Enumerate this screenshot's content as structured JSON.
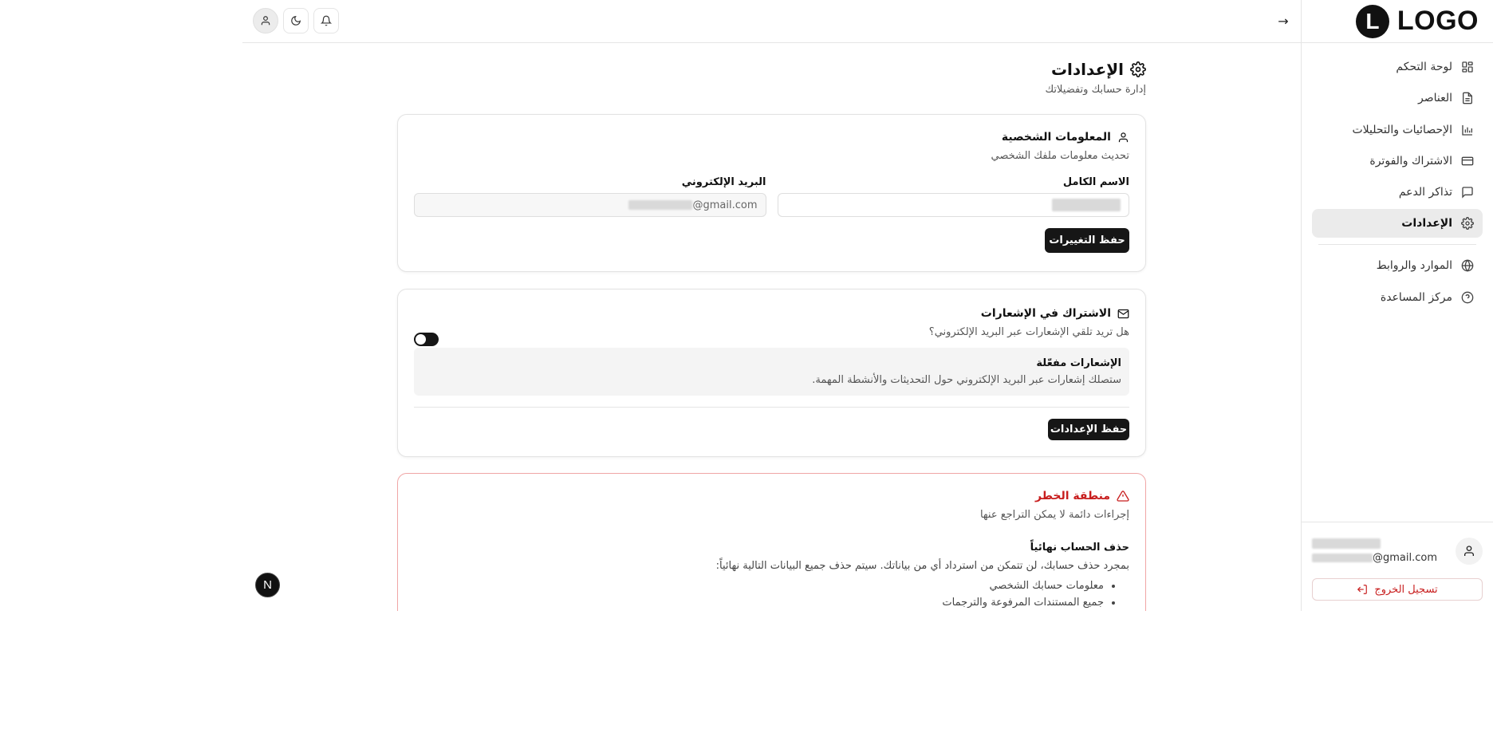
{
  "brand": {
    "logo_letter": "L",
    "logo_text": "LOGO"
  },
  "sidebar": {
    "items": [
      {
        "label": "لوحة التحكم",
        "icon": "dashboard-icon"
      },
      {
        "label": "العناصر",
        "icon": "document-icon"
      },
      {
        "label": "الإحصائيات والتحليلات",
        "icon": "bar-chart-icon"
      },
      {
        "label": "الاشتراك والفوترة",
        "icon": "credit-card-icon"
      },
      {
        "label": "تذاكر الدعم",
        "icon": "chat-icon"
      },
      {
        "label": "الإعدادات",
        "icon": "gear-icon",
        "active": true
      },
      {
        "label": "الموارد والروابط",
        "icon": "globe-icon"
      },
      {
        "label": "مركز المساعدة",
        "icon": "help-circle-icon"
      }
    ],
    "user": {
      "email_suffix": "@gmail.com"
    },
    "logout_label": "تسجيل الخروج"
  },
  "topbar": {
    "collapse_arrow": "→"
  },
  "page": {
    "title": "الإعدادات",
    "subtitle": "إدارة حسابك وتفضيلاتك"
  },
  "personal": {
    "title": "المعلومات الشخصية",
    "desc": "تحديث معلومات ملفك الشخصي",
    "name_label": "الاسم الكامل",
    "email_label": "البريد الإلكتروني",
    "email_suffix": "@gmail.com",
    "save_label": "حفظ التغييرات"
  },
  "notifications": {
    "title": "الاشتراك في الإشعارات",
    "desc": "هل تريد تلقي الإشعارات عبر البريد الإلكتروني؟",
    "enabled": false,
    "notice_title": "الإشعارات مفعّلة",
    "notice_desc": "ستصلك إشعارات عبر البريد الإلكتروني حول التحديثات والأنشطة المهمة.",
    "save_label": "حفظ الإعدادات"
  },
  "danger": {
    "title": "منطقة الخطر",
    "desc": "إجراءات دائمة لا يمكن التراجع عنها",
    "delete_title": "حذف الحساب نهائياً",
    "delete_text": "بمجرد حذف حسابك، لن تتمكن من استرداد أي من بياناتك. سيتم حذف جميع البيانات التالية نهائياً:",
    "items": [
      "معلومات حسابك الشخصي",
      "جميع المستندات المرفوعة والترجمات"
    ]
  },
  "badge": {
    "letter": "N"
  },
  "colors": {
    "accent": "#161616",
    "danger": "#c81e1e",
    "active_bg": "#ebebeb"
  }
}
